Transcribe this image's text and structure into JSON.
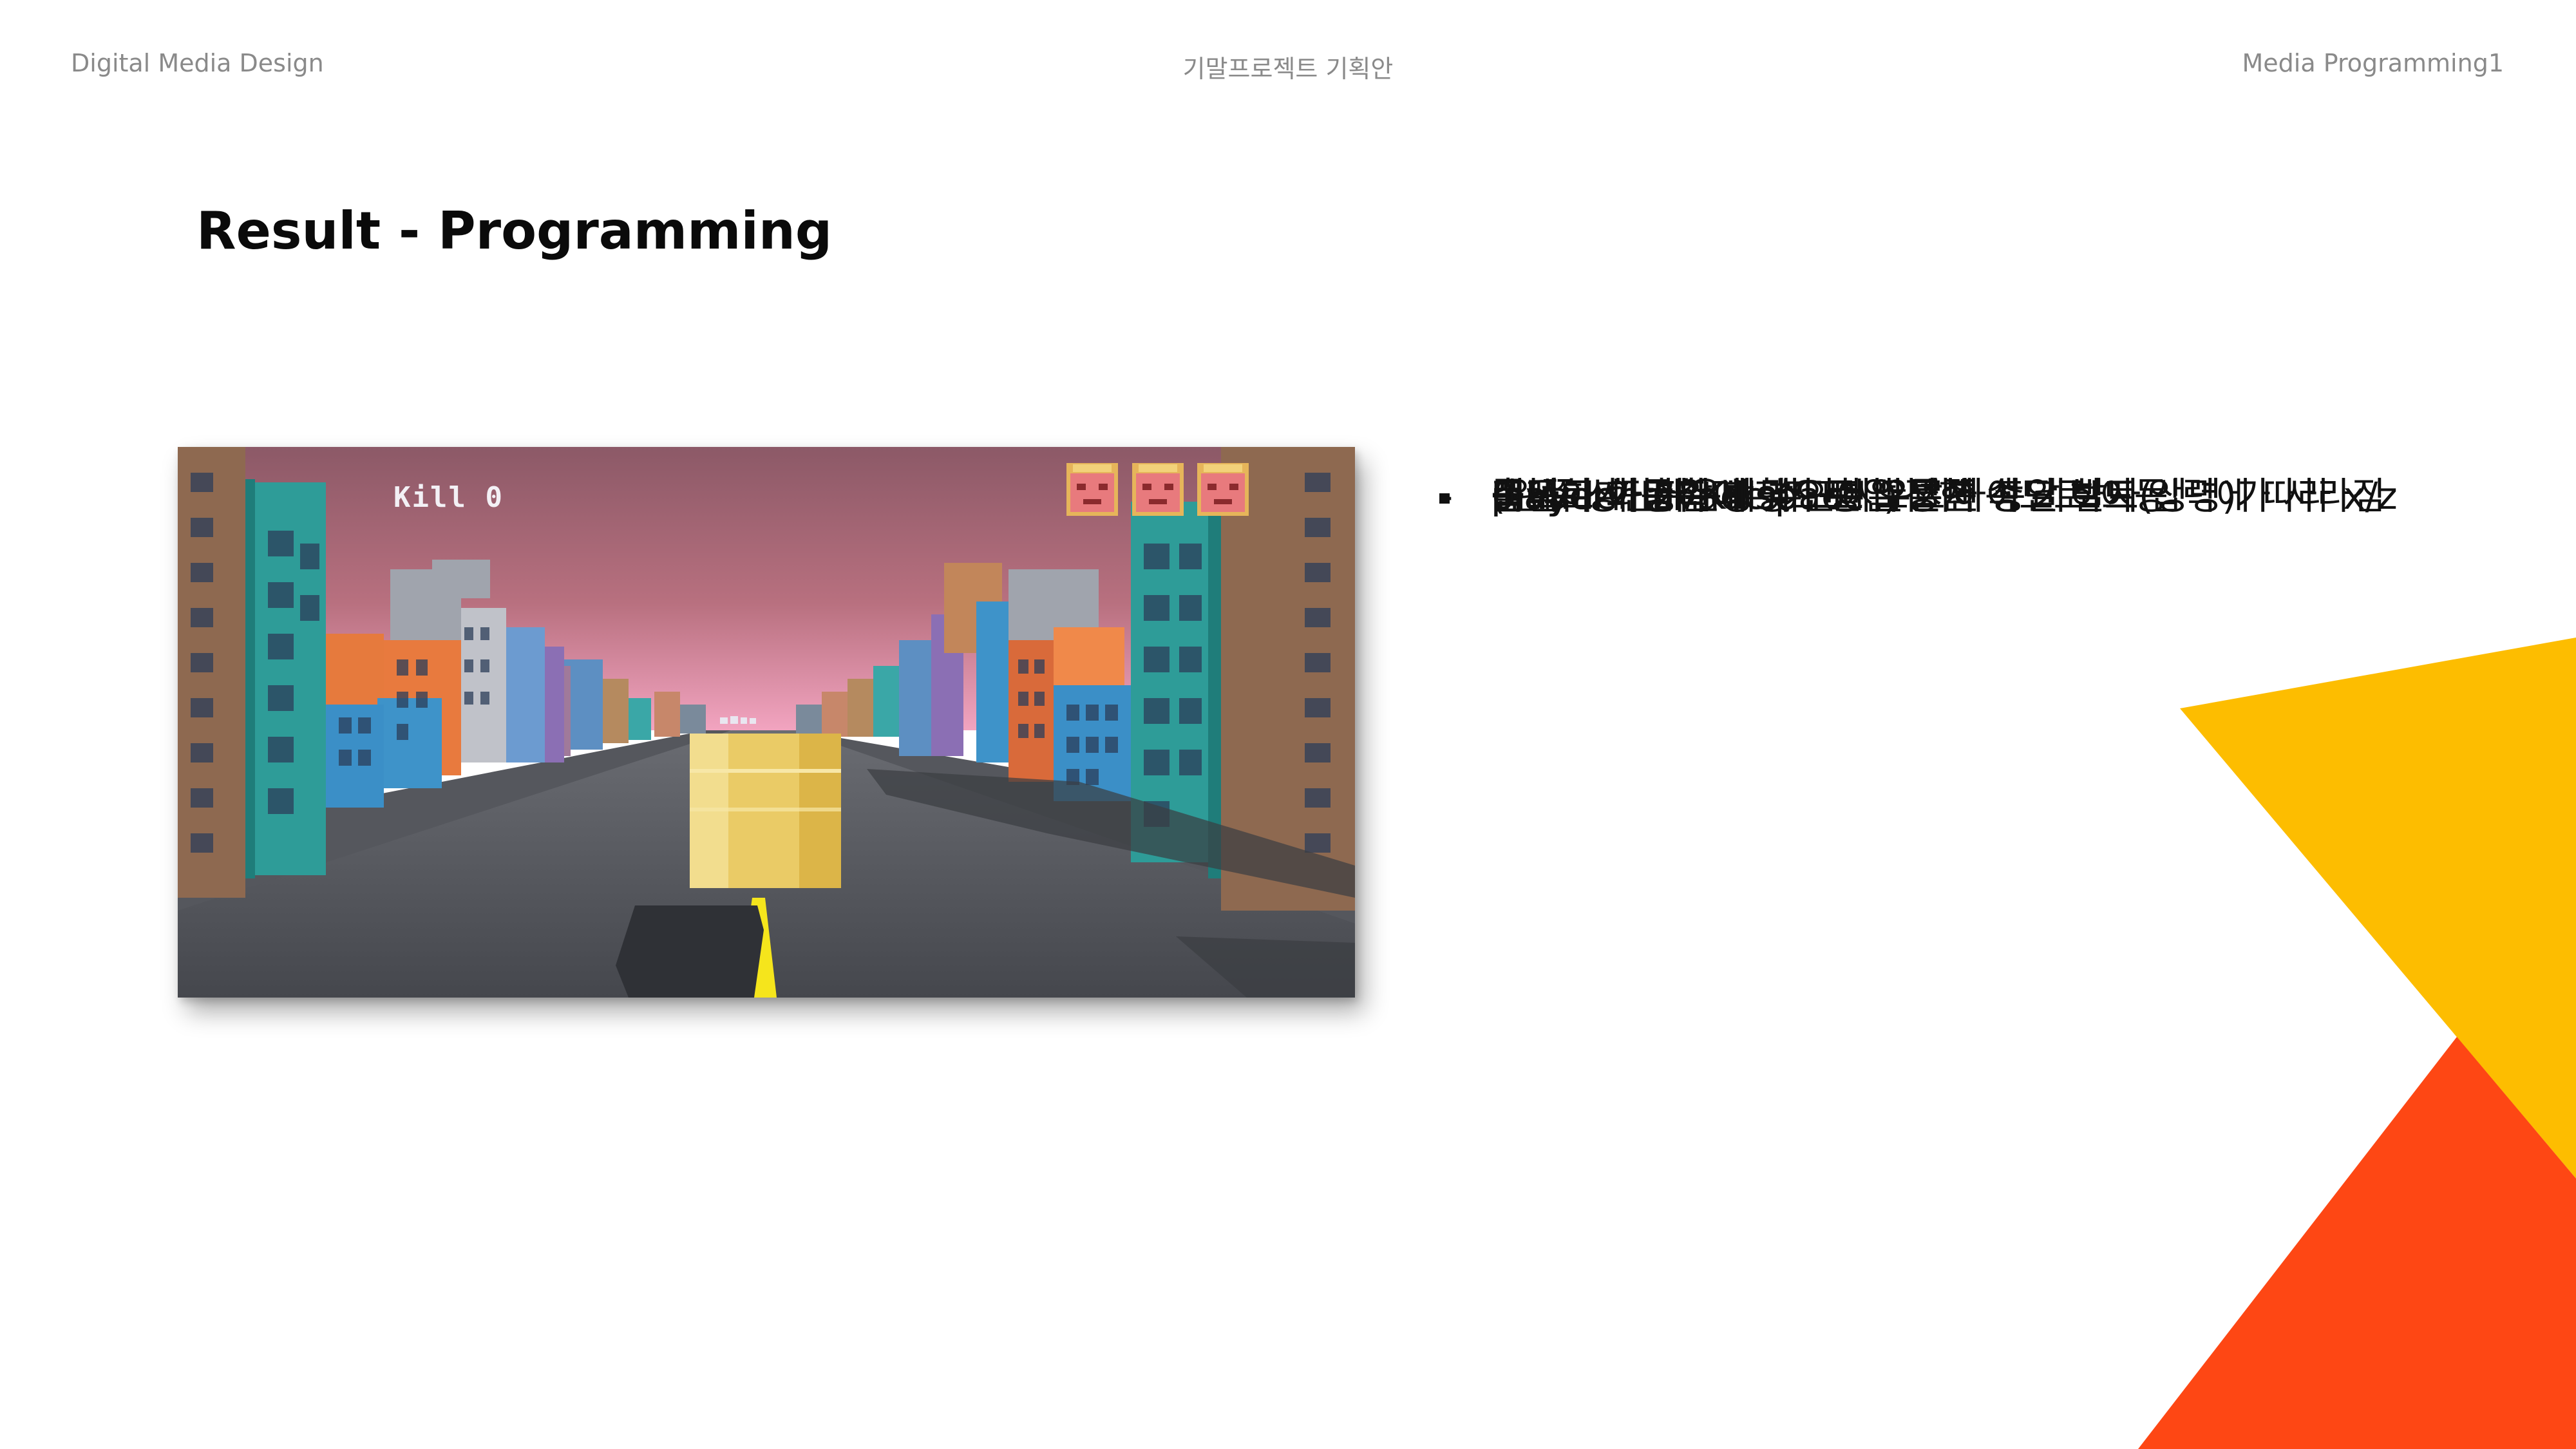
{
  "header": {
    "left": "Digital Media Design",
    "center": "기말프로젝트 기획안",
    "right": "Media Programming1"
  },
  "title": "Result - Programming",
  "game": {
    "hud_kill_label": "Kill 0",
    "lives": 3,
    "colors": {
      "sky_top": "#8c5967",
      "sky_horizon": "#f2a4c0",
      "road": "#4e5057",
      "center_line": "#f5e51c",
      "player": "#e8c75a"
    }
  },
  "bullets": [
    {
      "marker": "square",
      "text": "플레이 화면"
    },
    {
      "marker": "none",
      "text": ""
    },
    {
      "marker": "-",
      "text": "Player가 가운데 하단에 위치하여 키보드 입력에 따라 x/z"
    },
    {
      "marker": "none",
      "text": "축으로 이동하며 space 누르면 총알 발사"
    },
    {
      "marker": "none",
      "text": "(왼쪽 상단에 Kill 수 표시)"
    },
    {
      "marker": "-",
      "text": "player가 z축 방향으로 일정한 속도로 이동"
    },
    {
      "marker": "-",
      "text": "랜덤하게 Invader가 총알 발사"
    },
    {
      "marker": "-",
      "text": "Invader 총알에 맞으면 오른쪽 상단 하트(생명)가 사라짐"
    }
  ],
  "decoration": {
    "yellow": "#fdbd00",
    "orange": "#fe4714"
  }
}
